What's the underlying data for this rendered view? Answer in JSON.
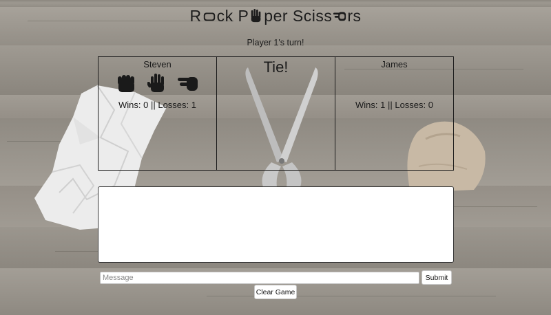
{
  "title": {
    "part1": "R",
    "part2": "ck P",
    "part3": "per Sciss",
    "part4": "rs",
    "icon_rock": "rock-hand-icon",
    "icon_paper": "paper-hand-icon",
    "icon_scissors": "scissors-hand-icon"
  },
  "status": {
    "turn_text": "Player 1's turn!"
  },
  "player1": {
    "name": "Steven",
    "record": "Wins: 0 || Losses: 1",
    "choices": [
      "rock-hand-icon",
      "paper-hand-icon",
      "scissors-hand-icon"
    ]
  },
  "result": {
    "text": "Tie!"
  },
  "player2": {
    "name": "James",
    "record": "Wins: 1 || Losses: 0"
  },
  "chat": {
    "placeholder": "Message",
    "submit_label": "Submit",
    "clear_label": "Clear Game"
  },
  "colors": {
    "background": "#9a948c",
    "panel_border": "#1a1a1a",
    "text": "#1c1c1c"
  }
}
